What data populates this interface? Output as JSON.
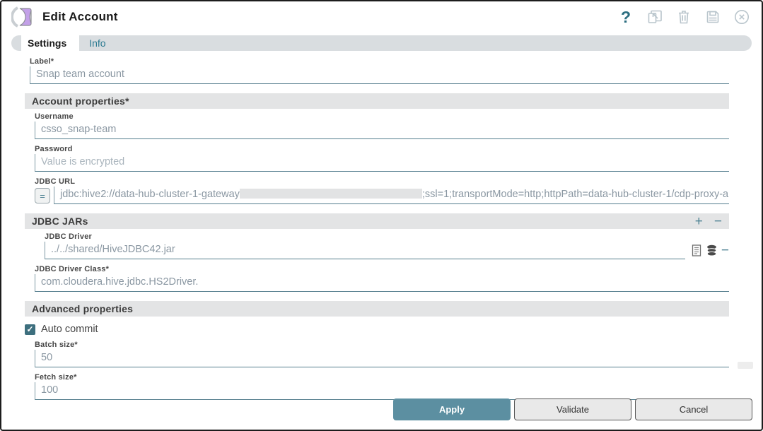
{
  "dialog": {
    "title": "Edit Account"
  },
  "header": {
    "icons": {
      "help": {
        "glyph": "?",
        "name": "question-mark"
      },
      "popout": {
        "name": "open-in-window"
      },
      "delete": {
        "name": "trash-can"
      },
      "save": {
        "name": "floppy-disk"
      },
      "close": {
        "name": "circle-x"
      }
    }
  },
  "tabs": {
    "settings": {
      "label": "Settings",
      "active": true
    },
    "info": {
      "label": "Info",
      "active": false
    }
  },
  "form": {
    "label_field": {
      "label": "Label*",
      "value": "Snap team account"
    },
    "account_properties": {
      "title": "Account properties*",
      "username": {
        "label": "Username",
        "value": "csso_snap-team"
      },
      "password": {
        "label": "Password",
        "placeholder": "Value is encrypted"
      },
      "jdbc_url": {
        "label": "JDBC URL",
        "expression_toggle": "=",
        "value_start": "jdbc:hive2://data-hub-cluster-1-gateway",
        "value_end": ";ssl=1;transportMode=http;httpPath=data-hub-cluster-1/cdp-proxy-a"
      },
      "jdbc_jars": {
        "title": "JDBC JARs",
        "add": "+",
        "remove": "−",
        "jdbc_driver": {
          "label": "JDBC Driver",
          "value": "../../shared/HiveJDBC42.jar",
          "remove": "−",
          "icons": {
            "file": "document-lines",
            "suggest": "database-stack"
          }
        }
      },
      "jdbc_driver_class": {
        "label": "JDBC Driver Class*",
        "value": "com.cloudera.hive.jdbc.HS2Driver."
      }
    },
    "advanced_properties": {
      "title": "Advanced properties",
      "auto_commit": {
        "label": "Auto commit",
        "checked": true,
        "checkmark": "✓"
      },
      "batch_size": {
        "label": "Batch size*",
        "value": "50"
      },
      "fetch_size": {
        "label": "Fetch size*",
        "value": "100"
      }
    }
  },
  "footer": {
    "apply": "Apply",
    "validate": "Validate",
    "cancel": "Cancel"
  },
  "colors": {
    "accent_teal": "#5c8fa1",
    "link_teal": "#2b7a91",
    "section_bar": "#e3e4e5",
    "underline": "#557e8e",
    "snap_purple": "#c3a0e8",
    "icon_gray": "#b9c5cc"
  }
}
